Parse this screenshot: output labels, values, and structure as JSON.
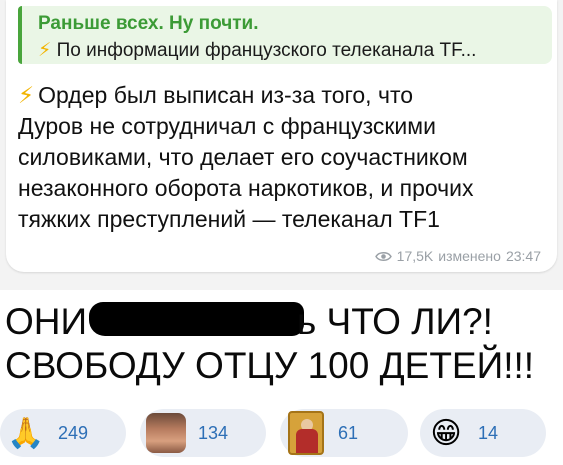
{
  "message": {
    "reply": {
      "title": "Раньше всех. Ну почти.",
      "bolt": "⚡",
      "text": "По информации французского телеканала TF..."
    },
    "bolt": "⚡",
    "lines": [
      "Ордер был выписан из-за того, что",
      "Дуров не сотрудничал с французскими",
      "силовиками, что делает его соучастником",
      "незаконного оборота наркотиков, и прочих",
      "тяжких преступлений — телеканал TF1"
    ],
    "views": "17,5K",
    "edited": "изменено",
    "time": "23:47"
  },
  "caption": {
    "line1_start": "ОНИ",
    "line1_end": "ь ЧТО ЛИ?!",
    "line2": "СВОБОДУ ОТЦУ 100 ДЕТЕЙ!!!"
  },
  "reactions": [
    {
      "emoji": "🙏",
      "icon": "praying-hands-emoji",
      "count": "249"
    },
    {
      "emoji": "",
      "icon": "muscular-man-sticker",
      "count": "134"
    },
    {
      "emoji": "",
      "icon": "saint-icon-sticker",
      "count": "61"
    },
    {
      "emoji": "😁",
      "icon": "grinning-face-emoji",
      "count": "14"
    }
  ],
  "colors": {
    "reply_accent": "#49a53c",
    "reaction_bg": "#e9edf4",
    "reaction_count": "#2d6fb6",
    "meta_gray": "#9aa0a6"
  }
}
